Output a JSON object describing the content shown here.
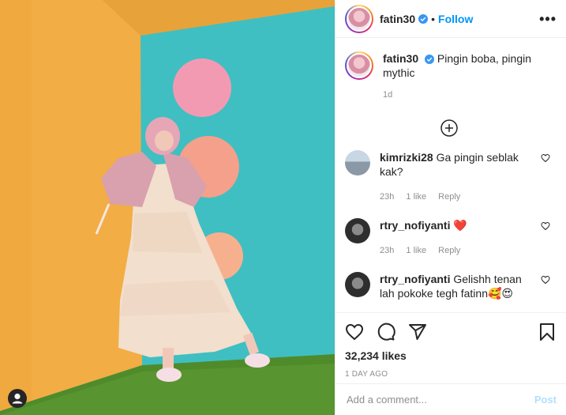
{
  "post": {
    "author": "fatin30",
    "follow_label": "Follow",
    "separator": "•",
    "more_label": "•••",
    "caption": "Pingin boba, pingin mythic",
    "caption_time": "1d",
    "likes": "32,234 likes",
    "posted_ago": "1 DAY AGO"
  },
  "comments": [
    {
      "user": "kimrizki28",
      "text": "Ga pingin seblak kak?",
      "time": "23h",
      "likes": "1 like",
      "reply": "Reply"
    },
    {
      "user": "rtry_nofiyanti",
      "text": "❤️",
      "time": "23h",
      "likes": "1 like",
      "reply": "Reply"
    },
    {
      "user": "rtry_nofiyanti",
      "text": "Gelishh tenan lah pokoke tegh fatinn🥰😍"
    }
  ],
  "composer": {
    "placeholder": "Add a comment...",
    "post_label": "Post"
  },
  "colors": {
    "accent": "#0095f6",
    "wall_left": "#f2ad45",
    "wall_right": "#3fbfc2",
    "floor": "#4f8b2a",
    "heart": "#ed4956"
  },
  "icons": [
    "verified-icon",
    "more-icon",
    "load-more-icon",
    "heart-icon",
    "comment-icon",
    "share-icon",
    "save-icon",
    "profile-badge-icon"
  ]
}
